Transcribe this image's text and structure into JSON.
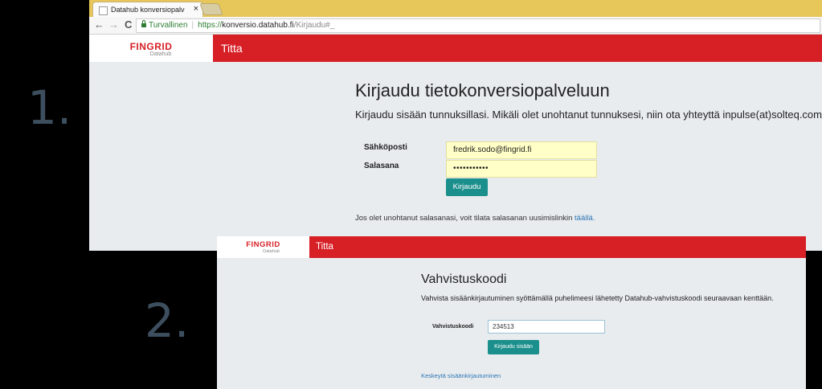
{
  "steps": {
    "first": "1.",
    "second": "2."
  },
  "browser": {
    "tab_title": "Datahub konversiopalvelu",
    "tab_close": "×",
    "back": "←",
    "forward": "→",
    "reload": "C",
    "secure_label": "Turvallinen",
    "url_scheme": "https://",
    "url_host": "konversio.datahub.fi",
    "url_path": "/Kirjaudu#_"
  },
  "logo": {
    "name": "FINGRID",
    "sub": "Datahub"
  },
  "brand": "Titta",
  "login": {
    "title": "Kirjaudu tietokonversiopalveluun",
    "subtitle": "Kirjaudu sisään tunnuksillasi. Mikäli olet unohtanut tunnuksesi, niin ota yhteyttä inpulse(at)solteq.com.",
    "email_label": "Sähköposti",
    "email_value": "fredrik.sodo@fingrid.fi",
    "password_label": "Salasana",
    "password_value": "•••••••••••",
    "submit_label": "Kirjaudu",
    "forgot_text": "Jos olet unohtanut salasanasi, voit tilata salasanan uusimislinkin ",
    "forgot_link": "täällä."
  },
  "verify": {
    "title": "Vahvistuskoodi",
    "subtitle": "Vahvista sisäänkirjautuminen syöttämällä puhelimeesi lähetetty Datahub-vahvistuskoodi seuraavaan kenttään.",
    "code_label": "Vahvistuskoodi",
    "code_value": "234513",
    "submit_label": "Kirjaudu sisään",
    "cancel_link": "Keskeytä sisäänkirjautuminen"
  },
  "colors": {
    "brand_red": "#d71f26",
    "accent_teal": "#1b8f8c",
    "link_blue": "#2d74b3",
    "tab_bar": "#e7c65a"
  }
}
